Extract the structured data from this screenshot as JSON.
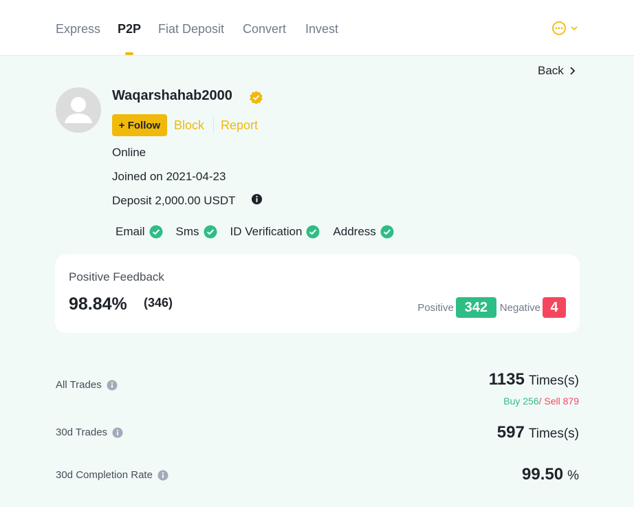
{
  "nav": {
    "tabs": [
      {
        "label": "Express"
      },
      {
        "label": "P2P"
      },
      {
        "label": "Fiat Deposit"
      },
      {
        "label": "Convert"
      },
      {
        "label": "Invest"
      }
    ],
    "active_tab": "P2P"
  },
  "back_label": "Back",
  "profile": {
    "username": "Waqarshahab2000",
    "follow_label": "+ Follow",
    "block_label": "Block",
    "report_label": "Report",
    "status": "Online",
    "joined": "Joined on 2021-04-23",
    "deposit": "Deposit 2,000.00 USDT",
    "verifications": [
      "Email",
      "Sms",
      "ID Verification",
      "Address"
    ]
  },
  "feedback": {
    "label": "Positive Feedback",
    "rate": "98.84%",
    "count": "(346)",
    "positive_label": "Positive",
    "positive_count": "342",
    "negative_label": "Negative",
    "negative_count": "4"
  },
  "stats": {
    "all_trades_label": "All Trades",
    "all_trades_value": "1135",
    "all_trades_unit": "Times(s)",
    "buy_text": "Buy 256",
    "sell_text": "/ Sell 879",
    "trades_30d_label": "30d Trades",
    "trades_30d_value": "597",
    "trades_30d_unit": "Times(s)",
    "completion_label": "30d Completion Rate",
    "completion_value": "99.50",
    "completion_unit": "%"
  },
  "colors": {
    "accent": "#f0b90b",
    "positive": "#2ebd85",
    "negative": "#f6465d",
    "background": "#f2faf8"
  },
  "icons": [
    "more-dots-icon",
    "chevron-down-icon",
    "chevron-right-icon",
    "verified-badge-icon",
    "info-icon",
    "check-circle-icon",
    "avatar-icon"
  ]
}
